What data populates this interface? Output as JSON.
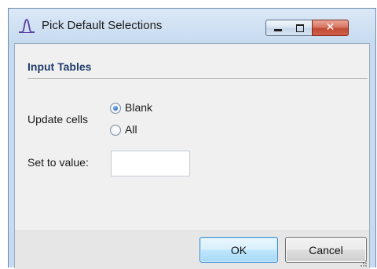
{
  "window": {
    "title": "Pick Default Selections",
    "icon": "bell-curve-icon",
    "controls": {
      "minimize_icon": "minimize-icon",
      "maximize_icon": "maximize-icon",
      "close_glyph": "✕"
    }
  },
  "section": {
    "title": "Input Tables"
  },
  "update_cells": {
    "label": "Update cells",
    "options": [
      {
        "label": "Blank",
        "checked": true
      },
      {
        "label": "All",
        "checked": false
      }
    ]
  },
  "set_value": {
    "label": "Set to value:",
    "value": ""
  },
  "buttons": {
    "ok": "OK",
    "cancel": "Cancel"
  },
  "colors": {
    "accent": "#2569b6",
    "section_title": "#1f3d6b",
    "app_icon": "#5b3ea6",
    "close_button": "#c14c35"
  }
}
